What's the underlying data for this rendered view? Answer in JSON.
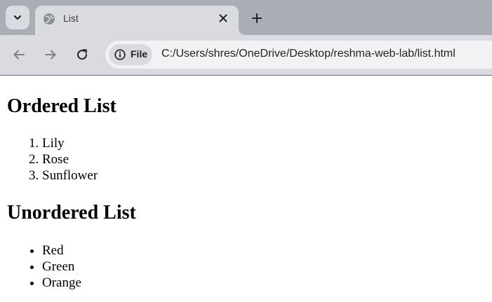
{
  "browser": {
    "tab": {
      "title": "List",
      "favicon": "globe-icon",
      "close": "close-icon"
    },
    "new_tab": "plus-icon",
    "tab_search": "chevron-down-icon",
    "nav": {
      "back": "arrow-left-icon",
      "forward": "arrow-right-icon",
      "reload": "reload-icon"
    },
    "omnibox": {
      "chip_icon": "info-icon",
      "chip_label": "File",
      "url": "C:/Users/shres/OneDrive/Desktop/reshma-web-lab/list.html"
    },
    "colors": {
      "tabstrip": "#a9adb6",
      "toolbar": "#d9dbe0",
      "omnibox": "#f1f2f4"
    }
  },
  "page": {
    "ordered_heading": "Ordered List",
    "ordered_items": [
      "Lily",
      "Rose",
      "Sunflower"
    ],
    "unordered_heading": "Unordered List",
    "unordered_items": [
      "Red",
      "Green",
      "Orange"
    ]
  }
}
